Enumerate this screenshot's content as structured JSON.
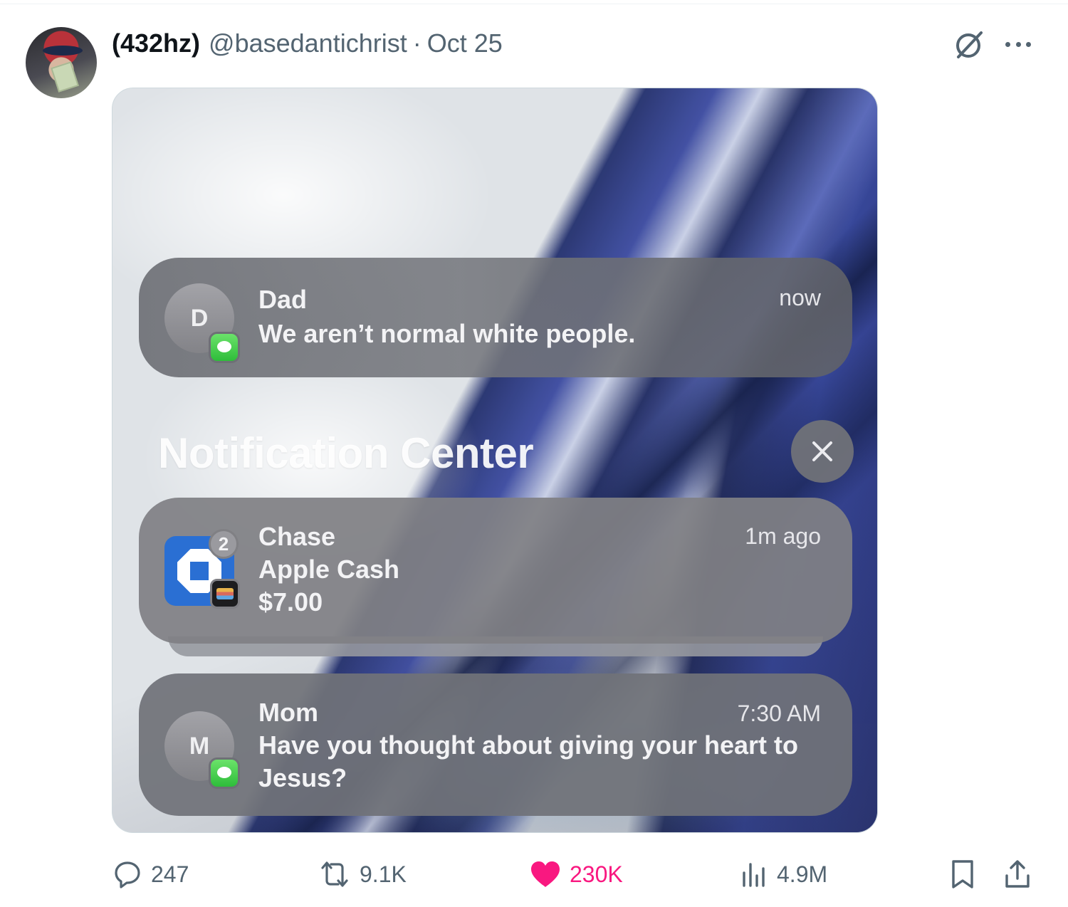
{
  "tweet": {
    "display_name": "(432hz)",
    "handle": "@basedantichrist",
    "separator": "·",
    "date": "Oct 25"
  },
  "media": {
    "notification_center_heading": "Notification Center",
    "notifications": [
      {
        "id": "dad",
        "avatar_letter": "D",
        "sender": "Dad",
        "message": "We aren’t normal white people.",
        "time": "now",
        "app_icon": "messages-icon"
      },
      {
        "id": "chase",
        "app": "Chase",
        "badge_count": "2",
        "line2": "Apple Cash",
        "line3": "$7.00",
        "time": "1m ago",
        "app_icon": "chase-logo",
        "secondary_icon": "wallet-icon"
      },
      {
        "id": "mom",
        "avatar_letter": "M",
        "sender": "Mom",
        "message": "Have you thought about giving your heart to Jesus?",
        "time": "7:30 AM",
        "app_icon": "messages-icon"
      }
    ]
  },
  "actions": {
    "replies": "247",
    "reposts": "9.1K",
    "likes": "230K",
    "views": "4.9M",
    "liked": true
  },
  "colors": {
    "text_primary": "#0f1419",
    "text_secondary": "#536471",
    "like_pink": "#f91880"
  }
}
